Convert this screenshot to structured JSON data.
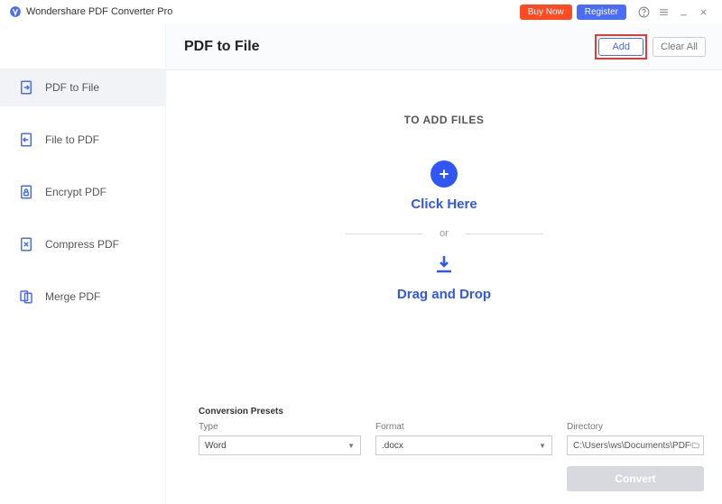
{
  "titlebar": {
    "app_title": "Wondershare PDF Converter Pro",
    "buy_label": "Buy Now",
    "register_label": "Register"
  },
  "sidebar": {
    "items": [
      {
        "label": "PDF to File",
        "active": true
      },
      {
        "label": "File to PDF",
        "active": false
      },
      {
        "label": "Encrypt PDF",
        "active": false
      },
      {
        "label": "Compress PDF",
        "active": false
      },
      {
        "label": "Merge PDF",
        "active": false
      }
    ]
  },
  "header": {
    "title": "PDF to File",
    "add_label": "Add",
    "clear_label": "Clear All"
  },
  "dropzone": {
    "title": "TO ADD FILES",
    "click_label": "Click Here",
    "or_label": "or",
    "drag_label": "Drag and Drop"
  },
  "footer": {
    "presets_title": "Conversion Presets",
    "type_label": "Type",
    "type_value": "Word",
    "format_label": "Format",
    "format_value": ".docx",
    "directory_label": "Directory",
    "directory_value": "C:\\Users\\ws\\Documents\\PDFConvert",
    "convert_label": "Convert"
  }
}
